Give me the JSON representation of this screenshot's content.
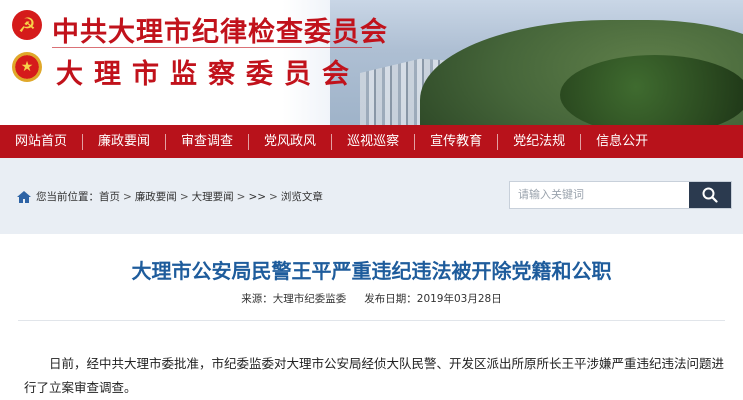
{
  "header": {
    "title_line1": "中共大理市纪律检查委员会",
    "title_line2": "大理市监察委员会",
    "party_emblem_icon": "party-emblem",
    "state_emblem_icon": "national-emblem",
    "brand_red": "#c1121b"
  },
  "nav": {
    "items": [
      {
        "label": "网站首页"
      },
      {
        "label": "廉政要闻"
      },
      {
        "label": "审查调查"
      },
      {
        "label": "党风政风"
      },
      {
        "label": "巡视巡察"
      },
      {
        "label": "宣传教育"
      },
      {
        "label": "党纪法规"
      },
      {
        "label": "信息公开"
      }
    ],
    "bg_color": "#b8121b"
  },
  "breadcrumb": {
    "prefix": "您当前位置：",
    "items": [
      "首页",
      "廉政要闻",
      "大理要闻",
      ">>",
      "浏览文章"
    ],
    "separator": ">"
  },
  "search": {
    "placeholder": "请输入关键词",
    "icon": "search-icon"
  },
  "article": {
    "title": "大理市公安局民警王平严重违纪违法被开除党籍和公职",
    "source": "来源：大理市纪委监委",
    "date": "发布日期：2019年03月28日",
    "paragraph1": "日前，经中共大理市委批准，市纪委监委对大理市公安局经侦大队民警、开发区派出所原所长王平涉嫌严重违纪违法问题进行了立案审查调查。",
    "title_color": "#1e5c9c"
  }
}
